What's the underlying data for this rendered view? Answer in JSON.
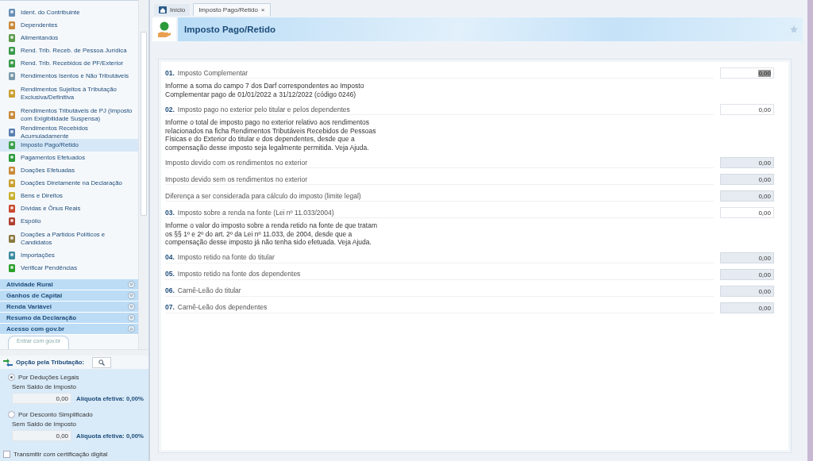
{
  "sidebar": {
    "items": [
      {
        "label": "Ident. do Contribuinte",
        "selected": false
      },
      {
        "label": "Dependentes",
        "selected": false
      },
      {
        "label": "Alimentandos",
        "selected": false
      },
      {
        "label": "Rend. Trib. Receb. de Pessoa Jurídica",
        "selected": false
      },
      {
        "label": "Rend. Trib. Recebidos de PF/Exterior",
        "selected": false
      },
      {
        "label": "Rendimentos Isentos e Não Tributáveis",
        "selected": false
      },
      {
        "label": "Rendimentos Sujeitos à Tributação Exclusiva/Definitiva",
        "selected": false
      },
      {
        "label": "Rendimentos Tributáveis de PJ (Imposto com Exigibilidade Suspensa)",
        "selected": false
      },
      {
        "label": "Rendimentos Recebidos Acumuladamente",
        "selected": false
      },
      {
        "label": "Imposto Pago/Retido",
        "selected": true
      },
      {
        "label": "Pagamentos Efetuados",
        "selected": false
      },
      {
        "label": "Doações Efetuadas",
        "selected": false
      },
      {
        "label": "Doações Diretamente na Declaração",
        "selected": false
      },
      {
        "label": "Bens e Direitos",
        "selected": false
      },
      {
        "label": "Dívidas e Ônus Reais",
        "selected": false
      },
      {
        "label": "Espólio",
        "selected": false
      },
      {
        "label": "Doações a Partidos Políticos e Candidatos",
        "selected": false
      },
      {
        "label": "Importações",
        "selected": false
      },
      {
        "label": "Verificar Pendências",
        "selected": false
      }
    ],
    "sections": [
      {
        "label": "Atividade Rural",
        "expanded": false
      },
      {
        "label": "Ganhos de Capital",
        "expanded": false
      },
      {
        "label": "Renda Variável",
        "expanded": false
      },
      {
        "label": "Resumo da Declaração",
        "expanded": false
      },
      {
        "label": "Acesso com gov.br",
        "expanded": true
      }
    ],
    "govbr_button": {
      "label": "Entrar com gov.br"
    },
    "tax_option": {
      "label": "Opção pela Tributação:",
      "options": [
        {
          "label": "Por Deduções Legais",
          "selected": true,
          "subtitle": "Sem Saldo de Imposto",
          "value": "0,00",
          "rate": "Alíquota efetiva: 0,00%"
        },
        {
          "label": "Por Desconto Simplificado",
          "selected": false,
          "subtitle": "Sem Saldo de Imposto",
          "value": "0,00",
          "rate": "Alíquota efetiva: 0,00%"
        }
      ]
    },
    "certification": {
      "label": "Transmitir com certificação digital",
      "checked": false
    }
  },
  "tabs": [
    {
      "label": "Início",
      "selected": false
    },
    {
      "label": "Imposto Pago/Retido",
      "selected": true,
      "close": "×"
    }
  ],
  "page": {
    "title": "Imposto Pago/Retido",
    "fields": [
      {
        "number": "01.",
        "label": "Imposto Complementar",
        "description": "Informe a soma do campo 7 dos Darf correspondentes ao Imposto Complementar pago de 01/01/2022 a 31/12/2022 (código 0246)",
        "value": "0,00",
        "readonly": false,
        "focused": true
      },
      {
        "number": "02.",
        "label": "Imposto pago no exterior pelo titular e pelos dependentes",
        "description": "Informe o total de imposto pago no exterior relativo aos rendimentos relacionados na ficha Rendimentos Tributáveis Recebidos de Pessoas Físicas e do Exterior do titular e dos dependentes, desde que a compensação desse imposto seja legalmente permitida. Veja Ajuda.",
        "value": "0,00",
        "readonly": false,
        "focused": false
      },
      {
        "label": "Imposto devido com os rendimentos no exterior",
        "value": "0,00",
        "readonly": true,
        "focused": false
      },
      {
        "label": "Imposto devido sem os rendimentos no exterior",
        "value": "0,00",
        "readonly": true,
        "focused": false
      },
      {
        "label": "Diferença a ser considerada para cálculo do imposto (limite legal)",
        "value": "0,00",
        "readonly": true,
        "focused": false
      },
      {
        "number": "03.",
        "label": "Imposto sobre a renda na fonte (Lei nº 11.033/2004)",
        "description": "Informe o valor do imposto sobre a renda retido na fonte de que tratam os §§ 1º e 2º do art. 2º da Lei nº 11.033, de 2004, desde que a compensação desse imposto já não tenha sido efetuada. Veja Ajuda.",
        "value": "0,00",
        "readonly": false,
        "focused": false
      },
      {
        "number": "04.",
        "label": "Imposto retido na fonte do titular",
        "value": "0,00",
        "readonly": true,
        "focused": false
      },
      {
        "number": "05.",
        "label": "Imposto retido na fonte dos dependentes",
        "value": "0,00",
        "readonly": true,
        "focused": false
      },
      {
        "number": "06.",
        "label": "Carnê-Leão do titular",
        "value": "0,00",
        "readonly": true,
        "focused": false
      },
      {
        "number": "07.",
        "label": "Carnê-Leão dos dependentes",
        "value": "0,00",
        "readonly": true,
        "focused": false
      }
    ]
  }
}
